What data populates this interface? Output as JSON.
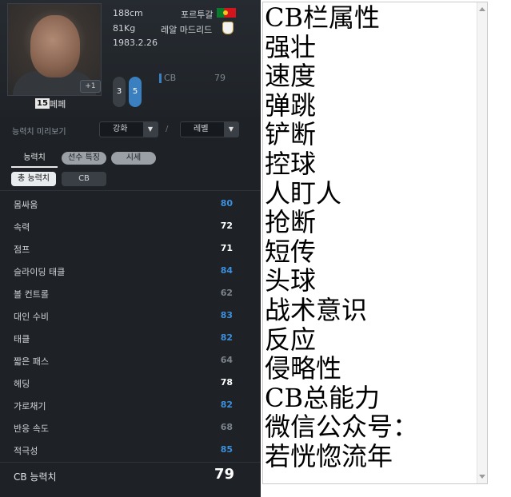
{
  "player": {
    "height": "188cm",
    "weight": "81Kg",
    "birthdate": "1983.2.26",
    "nationality": "포르투갈",
    "club": "레알 마드리드",
    "number": "15",
    "name": "페페",
    "grade_badge": "+1",
    "left_foot": "3",
    "right_foot": "5",
    "position": "CB",
    "position_ovr": "79"
  },
  "controls": {
    "preview_label": "능력치 미리보기",
    "enhance_label": "강화",
    "level_label": "레벨",
    "separator": "/"
  },
  "tabs": [
    {
      "label": "능력치",
      "active": true
    },
    {
      "label": "선수 특징",
      "active": false
    },
    {
      "label": "시세",
      "active": false
    }
  ],
  "chips": [
    {
      "label": "총 능력치",
      "active": true
    },
    {
      "label": "CB",
      "active": false
    }
  ],
  "stats": [
    {
      "label": "몸싸움",
      "value": "80",
      "color": "#3d8fdc"
    },
    {
      "label": "속력",
      "value": "72",
      "color": "#ffffff"
    },
    {
      "label": "점프",
      "value": "71",
      "color": "#ffffff"
    },
    {
      "label": "슬라이딩 태클",
      "value": "84",
      "color": "#3d8fdc"
    },
    {
      "label": "볼 컨트롤",
      "value": "62",
      "color": "#7b838c"
    },
    {
      "label": "대인 수비",
      "value": "83",
      "color": "#3d8fdc"
    },
    {
      "label": "태클",
      "value": "82",
      "color": "#3d8fdc"
    },
    {
      "label": "짧은 패스",
      "value": "64",
      "color": "#7b838c"
    },
    {
      "label": "헤딩",
      "value": "78",
      "color": "#ffffff"
    },
    {
      "label": "가로채기",
      "value": "82",
      "color": "#3d8fdc"
    },
    {
      "label": "반응 속도",
      "value": "68",
      "color": "#7b838c"
    },
    {
      "label": "적극성",
      "value": "85",
      "color": "#3d8fdc"
    }
  ],
  "total": {
    "label": "CB 능력치",
    "value": "79"
  },
  "text_lines": [
    "CB栏属性",
    "强壮",
    "速度",
    "弹跳",
    "铲断",
    "控球",
    "人盯人",
    "抢断",
    "短传",
    "头球",
    "战术意识",
    "反应",
    "侵略性",
    "CB总能力",
    "微信公众号：",
    "若恍惚流年"
  ],
  "icons": {
    "flag": "portugal-flag-icon",
    "crest": "real-madrid-crest-icon",
    "dropdown_arrow": "▼"
  }
}
